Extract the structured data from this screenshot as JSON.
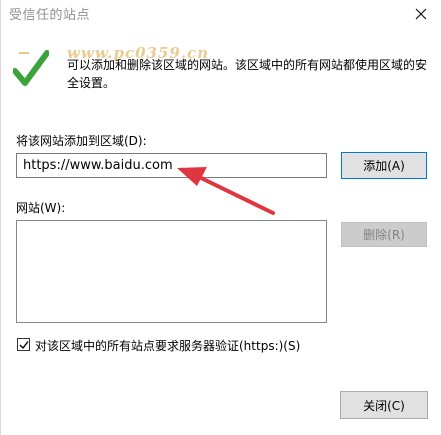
{
  "window": {
    "title": "受信任的站点",
    "close_glyph": "✕"
  },
  "watermark": {
    "text": "www.pc0359.cn"
  },
  "info": {
    "text": "可以添加和删除该区域的网站。该区域中的所有网站都使用区域的安全设置。"
  },
  "add_section": {
    "label": "将该网站添加到区域(D):",
    "input_value": "https://www.baidu.com",
    "add_button": "添加(A)"
  },
  "sites_section": {
    "label": "网站(W):",
    "items": [],
    "remove_button": "删除(R)"
  },
  "https_checkbox": {
    "checked": true,
    "label": "对该区域中的所有站点要求服务器验证(https:)(S)"
  },
  "footer": {
    "close_button": "关闭(C)"
  },
  "annotation": {
    "arrow_color": "#e0363f"
  },
  "colors": {
    "focus_border": "#0078d7",
    "check_green": "#3aa43a"
  }
}
